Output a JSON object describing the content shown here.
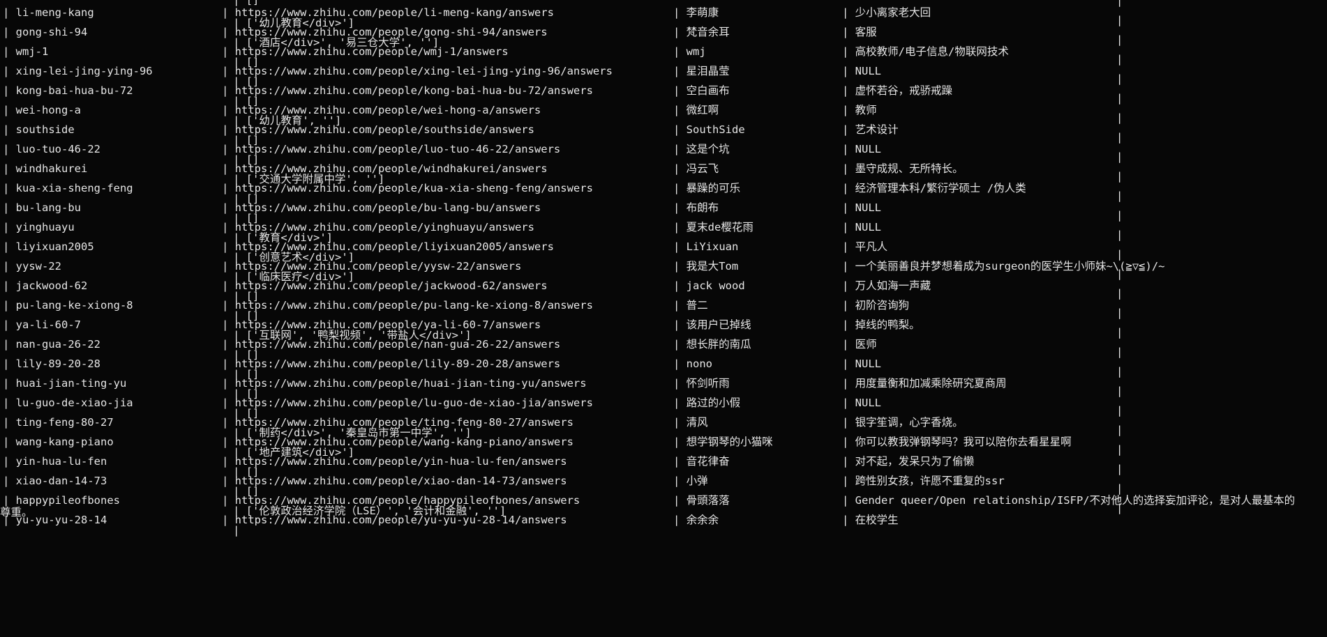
{
  "terminal": {
    "top_fragment": "| []",
    "rows": [
      {
        "user": "li-meng-kang",
        "url": "https://www.zhihu.com/people/li-meng-kang/answers",
        "name": "李萌康",
        "bio": "少小离家老大回",
        "tags": "['幼儿教育</div>']"
      },
      {
        "user": "gong-shi-94",
        "url": "https://www.zhihu.com/people/gong-shi-94/answers",
        "name": "梵音余耳",
        "bio": "客服",
        "tags": "['酒店</div>', '易三仓大学', '']"
      },
      {
        "user": "wmj-1",
        "url": "https://www.zhihu.com/people/wmj-1/answers",
        "name": "wmj",
        "bio": "高校教师/电子信息/物联网技术",
        "tags": "[]"
      },
      {
        "user": "xing-lei-jing-ying-96",
        "url": "https://www.zhihu.com/people/xing-lei-jing-ying-96/answers",
        "name": "星泪晶莹",
        "bio": "NULL",
        "tags": "[]"
      },
      {
        "user": "kong-bai-hua-bu-72",
        "url": "https://www.zhihu.com/people/kong-bai-hua-bu-72/answers",
        "name": "空白画布",
        "bio": "虚怀若谷，戒骄戒躁",
        "tags": "[]"
      },
      {
        "user": "wei-hong-a",
        "url": "https://www.zhihu.com/people/wei-hong-a/answers",
        "name": "微红啊",
        "bio": "教师",
        "tags": "['幼儿教育', '']"
      },
      {
        "user": "southside",
        "url": "https://www.zhihu.com/people/southside/answers",
        "name": "SouthSide",
        "bio": "艺术设计",
        "tags": "[]"
      },
      {
        "user": "luo-tuo-46-22",
        "url": "https://www.zhihu.com/people/luo-tuo-46-22/answers",
        "name": "这是个坑",
        "bio": "NULL",
        "tags": "[]"
      },
      {
        "user": "windhakurei",
        "url": "https://www.zhihu.com/people/windhakurei/answers",
        "name": "冯云飞",
        "bio": "墨守成规、无所特长。",
        "tags": "['交通大学附属中学', '']"
      },
      {
        "user": "kua-xia-sheng-feng",
        "url": "https://www.zhihu.com/people/kua-xia-sheng-feng/answers",
        "name": "暴躁的可乐",
        "bio": "经济管理本科/繁衍学硕士 /伪人类",
        "tags": "[]"
      },
      {
        "user": "bu-lang-bu",
        "url": "https://www.zhihu.com/people/bu-lang-bu/answers",
        "name": "布朗布",
        "bio": "NULL",
        "tags": "[]"
      },
      {
        "user": "yinghuayu",
        "url": "https://www.zhihu.com/people/yinghuayu/answers",
        "name": "夏末de樱花雨",
        "bio": "NULL",
        "tags": "['教育</div>']"
      },
      {
        "user": "liyixuan2005",
        "url": "https://www.zhihu.com/people/liyixuan2005/answers",
        "name": "LiYixuan",
        "bio": "平凡人",
        "tags": "['创意艺术</div>']"
      },
      {
        "user": "yysw-22",
        "url": "https://www.zhihu.com/people/yysw-22/answers",
        "name": "我是大Tom",
        "bio": "一个美丽善良并梦想着成为surgeon的医学生小师妹~\\(≧▽≦)/~",
        "tags": "['临床医疗</div>']"
      },
      {
        "user": "jackwood-62",
        "url": "https://www.zhihu.com/people/jackwood-62/answers",
        "name": "jack wood",
        "bio": "万人如海一声藏",
        "tags": "[]"
      },
      {
        "user": "pu-lang-ke-xiong-8",
        "url": "https://www.zhihu.com/people/pu-lang-ke-xiong-8/answers",
        "name": "普二",
        "bio": "初阶咨询狗",
        "tags": "[]"
      },
      {
        "user": "ya-li-60-7",
        "url": "https://www.zhihu.com/people/ya-li-60-7/answers",
        "name": "该用户已掉线",
        "bio": "掉线的鸭梨。",
        "tags": "['互联网', '鸭梨视频', '带盐人</div>']"
      },
      {
        "user": "nan-gua-26-22",
        "url": "https://www.zhihu.com/people/nan-gua-26-22/answers",
        "name": "想长胖的南瓜",
        "bio": "医师",
        "tags": "[]"
      },
      {
        "user": "lily-89-20-28",
        "url": "https://www.zhihu.com/people/lily-89-20-28/answers",
        "name": "nono",
        "bio": "NULL",
        "tags": "[]"
      },
      {
        "user": "huai-jian-ting-yu",
        "url": "https://www.zhihu.com/people/huai-jian-ting-yu/answers",
        "name": "怀剑听雨",
        "bio": "用度量衡和加减乘除研究夏商周",
        "tags": "[]"
      },
      {
        "user": "lu-guo-de-xiao-jia",
        "url": "https://www.zhihu.com/people/lu-guo-de-xiao-jia/answers",
        "name": "路过的小假",
        "bio": "NULL",
        "tags": "[]"
      },
      {
        "user": "ting-feng-80-27",
        "url": "https://www.zhihu.com/people/ting-feng-80-27/answers",
        "name": "清风",
        "bio": "银字笙调，心字香烧。",
        "tags": "['制药</div>', '秦皇岛市第一中学', '']"
      },
      {
        "user": "wang-kang-piano",
        "url": "https://www.zhihu.com/people/wang-kang-piano/answers",
        "name": "想学钢琴的小猫咪",
        "bio": "你可以教我弹钢琴吗？我可以陪你去看星星啊",
        "tags": "['地产建筑</div>']"
      },
      {
        "user": "yin-hua-lu-fen",
        "url": "https://www.zhihu.com/people/yin-hua-lu-fen/answers",
        "name": "音花律奋",
        "bio": "对不起，发呆只为了偷懒",
        "tags": "[]"
      },
      {
        "user": "xiao-dan-14-73",
        "url": "https://www.zhihu.com/people/xiao-dan-14-73/answers",
        "name": "小弹",
        "bio": "跨性别女孩，许愿不重复的ssr",
        "tags": "[]"
      },
      {
        "user": "happypileofbones",
        "url": "https://www.zhihu.com/people/happypileofbones/answers",
        "name": "骨頭落落",
        "bio": "Gender queer/Open relationship/ISFP/不对他人的选择妄加评论，是对人最基本的",
        "wrap": "尊重。",
        "tags": "['伦敦政治经济学院（LSE）', '会计和金融', '']"
      },
      {
        "user": "yu-yu-yu-28-14",
        "url": "https://www.zhihu.com/people/yu-yu-yu-28-14/answers",
        "name": "余余余",
        "bio": "在校学生",
        "tags": ""
      }
    ]
  }
}
